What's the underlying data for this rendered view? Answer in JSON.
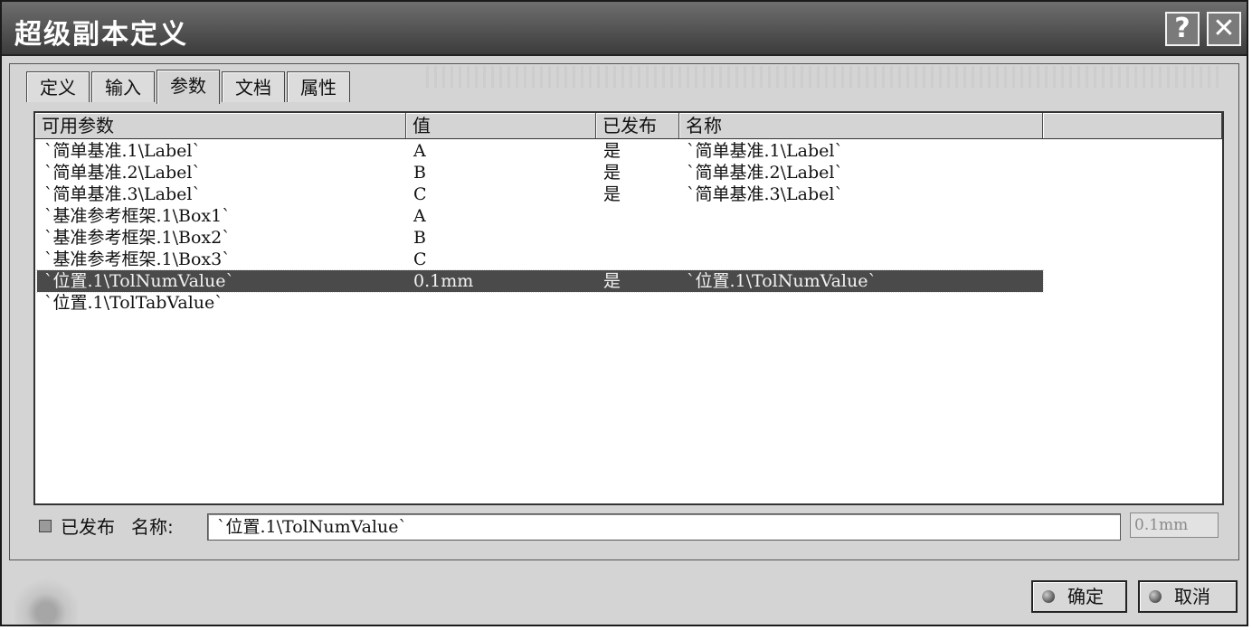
{
  "window": {
    "title": "超级副本定义",
    "help_label": "?",
    "close_label": "✕"
  },
  "tabs": [
    {
      "label": "定义"
    },
    {
      "label": "输入"
    },
    {
      "label": "参数",
      "active": true
    },
    {
      "label": "文档"
    },
    {
      "label": "属性"
    }
  ],
  "table": {
    "headers": [
      "可用参数",
      "值",
      "已发布",
      "名称",
      ""
    ],
    "rows": [
      {
        "param": "`简单基准.1\\Label`",
        "value": "A",
        "published": "是",
        "name": "`简单基准.1\\Label`"
      },
      {
        "param": "`简单基准.2\\Label`",
        "value": "B",
        "published": "是",
        "name": "`简单基准.2\\Label`"
      },
      {
        "param": "`简单基准.3\\Label`",
        "value": "C",
        "published": "是",
        "name": "`简单基准.3\\Label`"
      },
      {
        "param": "`基准参考框架.1\\Box1`",
        "value": "A",
        "published": "",
        "name": ""
      },
      {
        "param": "`基准参考框架.1\\Box2`",
        "value": "B",
        "published": "",
        "name": ""
      },
      {
        "param": "`基准参考框架.1\\Box3`",
        "value": "C",
        "published": "",
        "name": ""
      },
      {
        "param": "`位置.1\\TolNumValue`",
        "value": "0.1mm",
        "published": "是",
        "name": "`位置.1\\TolNumValue`",
        "selected": true
      },
      {
        "param": "`位置.1\\TolTabValue`",
        "value": "",
        "published": "",
        "name": ""
      }
    ]
  },
  "bottom": {
    "published_label": "已发布",
    "name_label": "名称:",
    "name_value": "`位置.1\\TolNumValue`",
    "value_display": "0.1mm"
  },
  "buttons": {
    "ok_label": "确定",
    "cancel_label": "取消"
  }
}
